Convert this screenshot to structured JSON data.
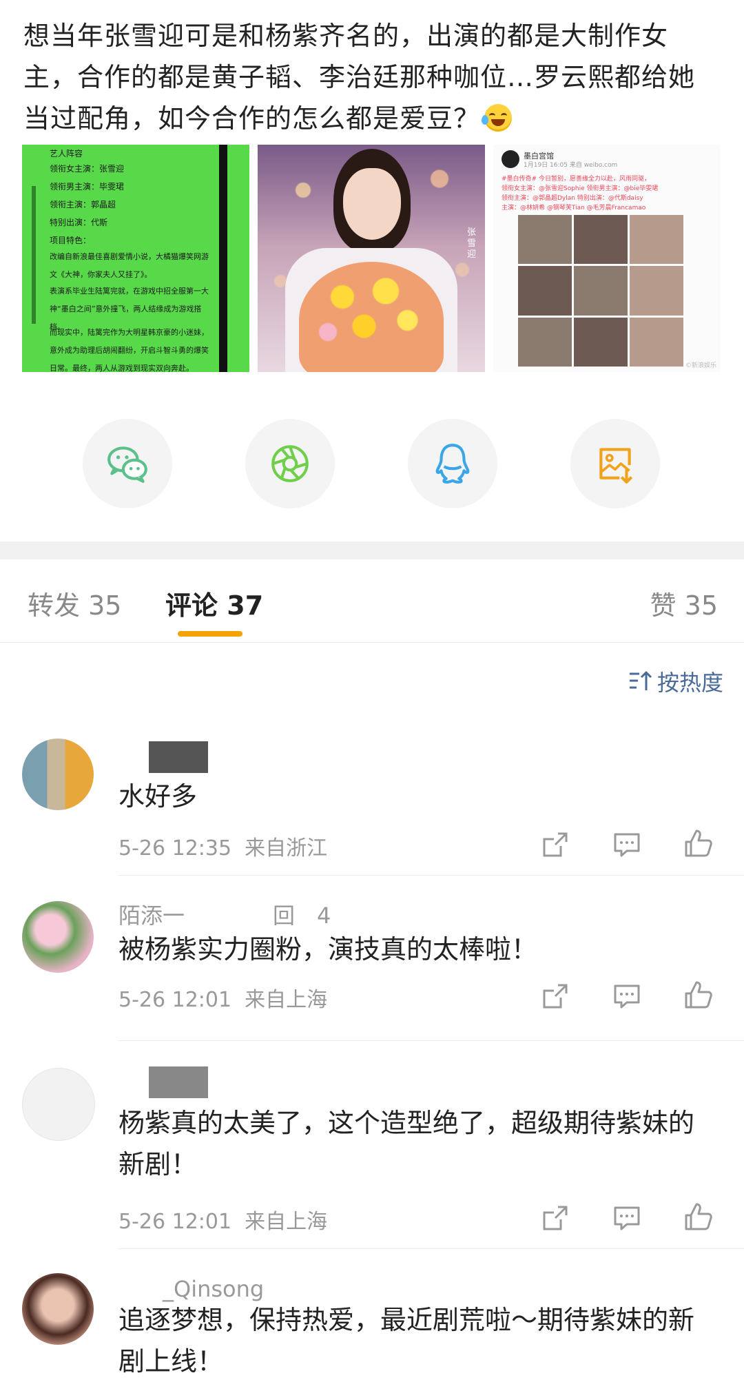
{
  "post": {
    "text": "想当年张雪迎可是和杨紫齐名的，出演的都是大制作女主，合作的都是黄子韬、李治廷那种咖位…罗云熙都给她当过配角，如今合作的怎么都是爱豆？"
  },
  "images": {
    "poster": {
      "title": "艺人阵容",
      "roles": [
        "领衔女主演：张雪迎",
        "领衔男主演：毕雯珺",
        "领衔主演：郭晶超",
        "特别出演：代斯"
      ],
      "features_label": "项目特色：",
      "paragraphs": [
        "改编自新浪最佳喜剧爱情小说，大橘猫爆笑网游文《大神，你家夫人又挂了》。",
        "表演系毕业生陆篱完就，在游戏中招全服第一大神“墨白之间”意外撞飞，两人结缘成为游戏搭档。",
        "而现实中，陆篱完作为大明星韩京豪的小迷妹，意外成为助理后胡闹翻纷，开启斗智斗勇的爆笑日常。最终，两人从游戏到现实双向奔赴。"
      ]
    },
    "photo": {
      "vertical_caption": "张雪迎"
    },
    "weibo": {
      "account": "墨白宫馆",
      "meta": "1月19日 16:05 来自 weibo.com",
      "lines": [
        "#墨白传奇# 今日暂别，愿善缘全力以赴，风雨同驱，",
        "领衔女主演：@张雪迎Sophie 领衔男主演：@bie毕雯珺",
        "领衔主演：@郭晶超Dylan 特别出演：@代斯daisy",
        "主演：@林妍希 @钢琴芙Tian @毛芳晨Francamao"
      ],
      "watermark": "©新浪娱乐"
    }
  },
  "share": {
    "wechat": "wechat-icon",
    "moments": "moments-icon",
    "qq": "qq-icon",
    "save": "save-image-icon"
  },
  "tabs": [
    {
      "label": "转发",
      "count": "35"
    },
    {
      "label": "评论",
      "count": "37"
    },
    {
      "label": "赞",
      "count": "35"
    }
  ],
  "sort": {
    "label": "按热度"
  },
  "comments": [
    {
      "name": "",
      "text": "水好多",
      "time": "5-26 12:35",
      "location": "来自浙江"
    },
    {
      "name": "陌添一　　　　回　4",
      "text": "被杨紫实力圈粉，演技真的太棒啦！",
      "time": "5-26 12:01",
      "location": "来自上海"
    },
    {
      "name": "",
      "text": "杨紫真的太美了，这个造型绝了，超级期待紫妹的新剧！",
      "time": "5-26 12:01",
      "location": "来自上海"
    },
    {
      "name": "　　_Qinsong",
      "text": "追逐梦想，保持热爱，最近剧荒啦～期待紫妹的新剧上线！",
      "time": "",
      "location": ""
    }
  ],
  "colors": {
    "accent": "#f5a300",
    "link": "#4a6a9a",
    "wechat": "#5bc08b",
    "moments": "#6fcf4a",
    "qq": "#3aa6e8",
    "save": "#f0a21a"
  }
}
